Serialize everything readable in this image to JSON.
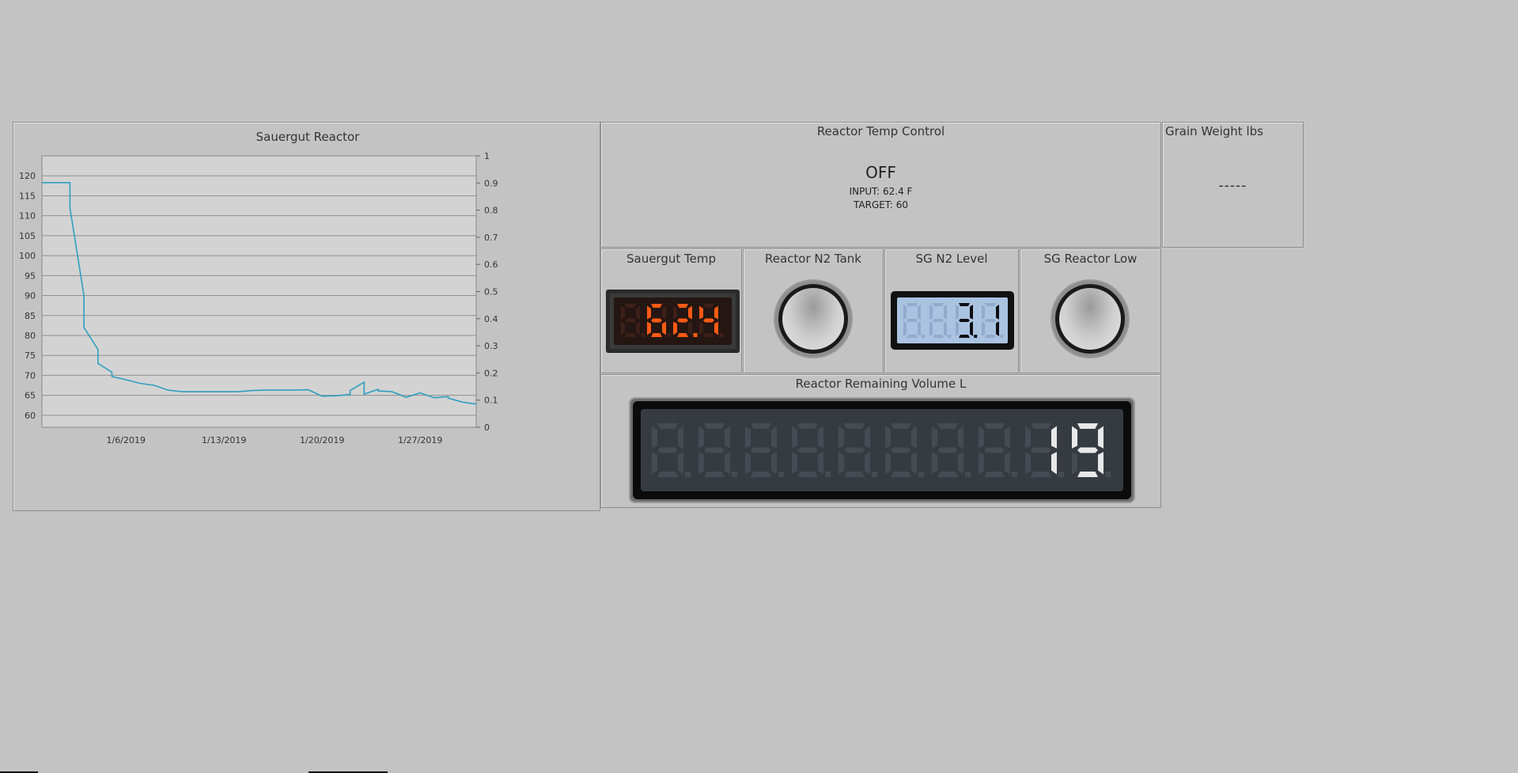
{
  "chart": {
    "title": "Sauergut Reactor"
  },
  "chart_data": {
    "type": "line",
    "title": "Sauergut Reactor",
    "x_tick_labels": [
      "1/6/2019",
      "1/13/2019",
      "1/20/2019",
      "1/27/2019"
    ],
    "x_range": [
      "12/31/2018",
      "1/31/2019"
    ],
    "y_left_range": [
      57,
      125
    ],
    "y_left_ticks": [
      60,
      65,
      70,
      75,
      80,
      85,
      90,
      95,
      100,
      105,
      110,
      115,
      120
    ],
    "y_right_range": [
      0,
      1
    ],
    "y_right_ticks": [
      0,
      0.1,
      0.2,
      0.3,
      0.4,
      0.5,
      0.6,
      0.7,
      0.8,
      0.9,
      1
    ],
    "grid": true,
    "color": "#2e9fbf",
    "series": [
      {
        "x": [
          "12/31/2018",
          "1/1/2019",
          "1/2/2019",
          "1/2/2019",
          "1/3/2019",
          "1/3/2019",
          "1/4/2019",
          "1/4/2019",
          "1/5/2019",
          "1/5/2019",
          "1/6/2019",
          "1/7/2019",
          "1/8/2019",
          "1/9/2019",
          "1/10/2019",
          "1/12/2019",
          "1/14/2019",
          "1/15/2019",
          "1/16/2019",
          "1/18/2019",
          "1/19/2019",
          "1/20/2019",
          "1/21/2019",
          "1/22/2019",
          "1/22/2019",
          "1/23/2019",
          "1/23/2019",
          "1/24/2019",
          "1/24/2019",
          "1/25/2019",
          "1/26/2019",
          "1/27/2019",
          "1/28/2019",
          "1/29/2019",
          "1/29/2019",
          "1/30/2019",
          "1/31/2019"
        ],
        "y": [
          118.3,
          118.3,
          118.3,
          112,
          90,
          82,
          76.5,
          73,
          70.8,
          69.7,
          68.9,
          68,
          67.5,
          66.3,
          65.9,
          65.9,
          65.9,
          66.2,
          66.3,
          66.3,
          66.4,
          64.8,
          64.9,
          65.2,
          66.2,
          68.3,
          65.3,
          66.5,
          66.1,
          65.9,
          64.5,
          65.6,
          64.4,
          64.7,
          64.3,
          63.3,
          62.8
        ]
      }
    ]
  },
  "temp_control": {
    "title": "Reactor Temp Control",
    "state": "OFF",
    "input": "INPUT: 62.4 F",
    "target": "TARGET: 60"
  },
  "grain": {
    "title": "Grain Weight lbs",
    "value": "-----"
  },
  "tiles": {
    "sauergut_temp": {
      "title": "Sauergut Temp",
      "value": "62.4",
      "color": "#ff5a14"
    },
    "n2_tank": {
      "title": "Reactor N2 Tank"
    },
    "n2_level": {
      "title": "SG N2 Level",
      "value": "3.1"
    },
    "reactor_low": {
      "title": "SG Reactor Low"
    }
  },
  "volume": {
    "title": "Reactor Remaining Volume L",
    "value": "19"
  },
  "icons": [
    "indicator-lamp-icon",
    "indicator-lamp-icon"
  ]
}
